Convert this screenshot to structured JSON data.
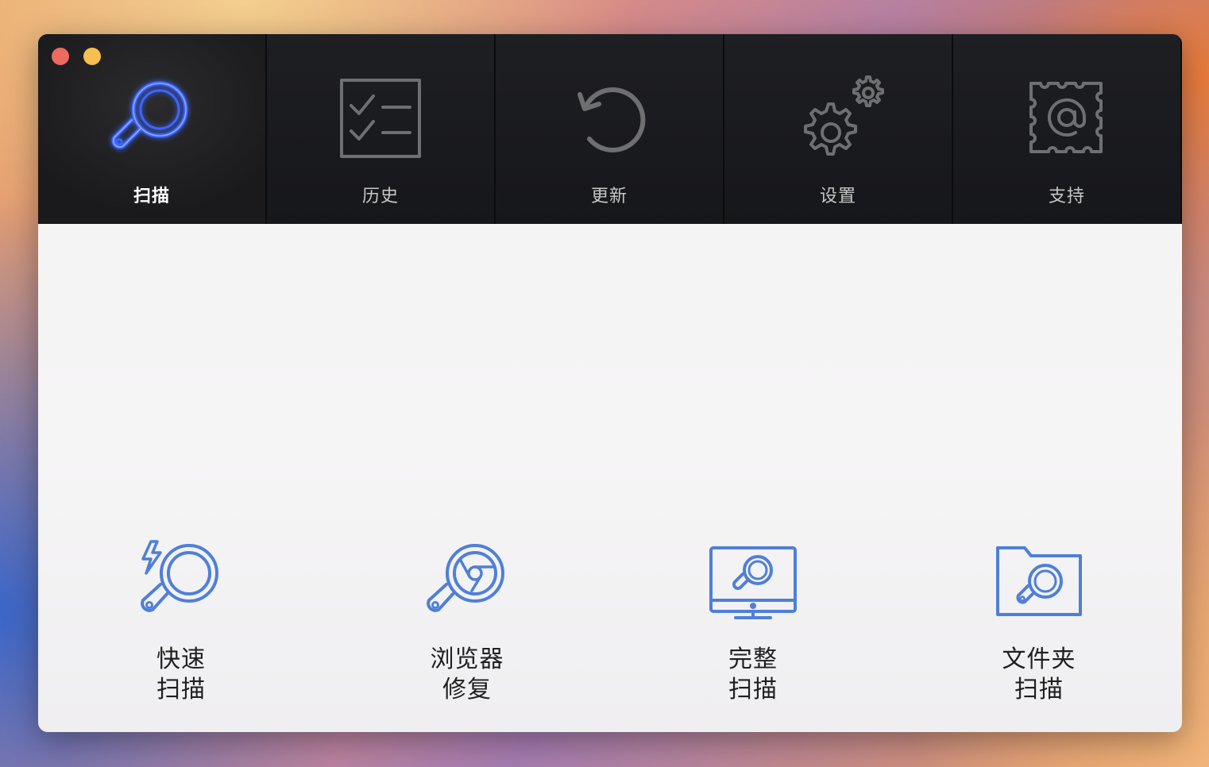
{
  "toolbar": {
    "tabs": [
      {
        "label": "扫描",
        "icon": "scan-icon",
        "active": true
      },
      {
        "label": "历史",
        "icon": "checklist-icon",
        "active": false
      },
      {
        "label": "更新",
        "icon": "refresh-icon",
        "active": false
      },
      {
        "label": "设置",
        "icon": "gears-icon",
        "active": false
      },
      {
        "label": "支持",
        "icon": "at-stamp-icon",
        "active": false
      }
    ]
  },
  "scan_options": [
    {
      "line1": "快速",
      "line2": "扫描",
      "icon": "quick-scan-icon"
    },
    {
      "line1": "浏览器",
      "line2": "修复",
      "icon": "browser-repair-icon"
    },
    {
      "line1": "完整",
      "line2": "扫描",
      "icon": "full-scan-icon"
    },
    {
      "line1": "文件夹",
      "line2": "扫描",
      "icon": "folder-scan-icon"
    }
  ],
  "colors": {
    "accent": "#4f7fd8",
    "toolbar_bg": "#17181c",
    "tab_icon": "#6f6f72",
    "active_glow": "#3d6cff"
  }
}
